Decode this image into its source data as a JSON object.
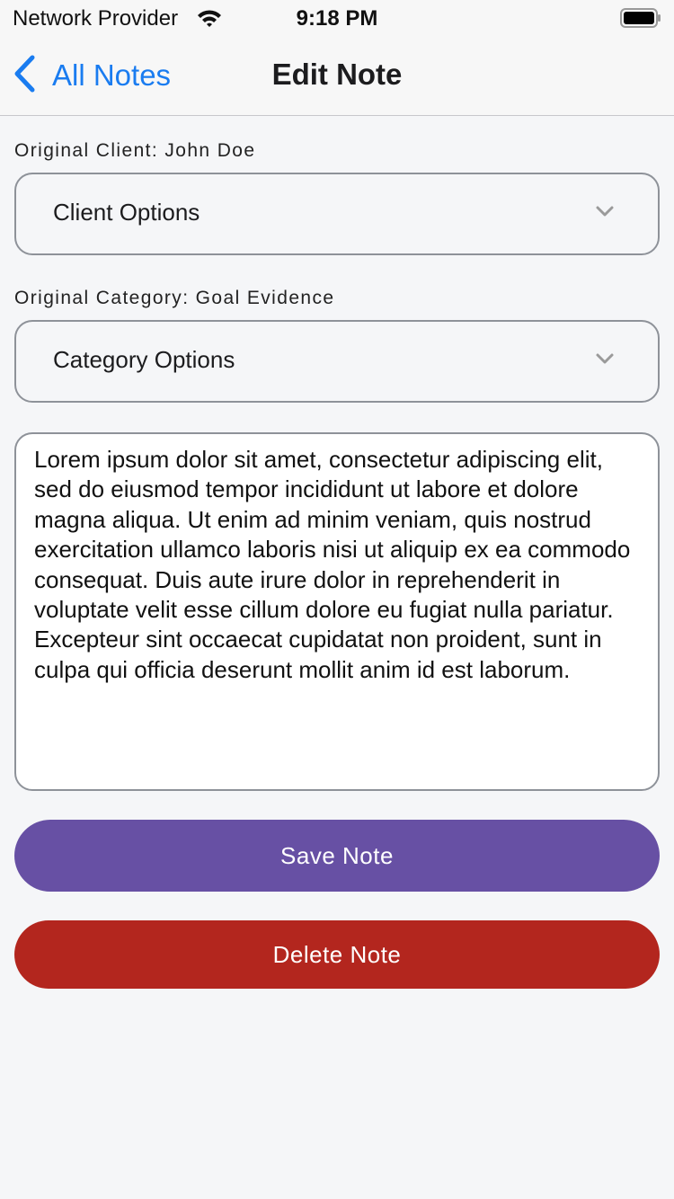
{
  "status_bar": {
    "carrier": "Network Provider",
    "time": "9:18 PM",
    "icons": [
      "wifi-icon",
      "battery-icon"
    ]
  },
  "nav": {
    "back_label": "All Notes",
    "back_icon": "chevron-left-icon",
    "title": "Edit Note"
  },
  "client": {
    "label": "Original Client: John Doe",
    "select_value": "Client Options"
  },
  "category": {
    "label": "Original Category: Goal Evidence",
    "select_value": "Category Options"
  },
  "note": {
    "text": "Lorem ipsum dolor sit amet, consectetur adipiscing elit, sed do eiusmod tempor incididunt ut labore et dolore magna aliqua. Ut enim ad minim veniam, quis nostrud exercitation ullamco laboris nisi ut aliquip ex ea commodo consequat. Duis aute irure dolor in reprehenderit in voluptate velit esse cillum dolore eu fugiat nulla pariatur. Excepteur sint occaecat cupidatat non proident, sunt in culpa qui officia deserunt mollit anim id est laborum."
  },
  "actions": {
    "save_label": "Save Note",
    "delete_label": "Delete Note"
  },
  "colors": {
    "accent_blue": "#1a7cf0",
    "save_button": "#6750a4",
    "delete_button": "#b3261e",
    "background": "#f5f6f8",
    "border": "#8e9299"
  }
}
